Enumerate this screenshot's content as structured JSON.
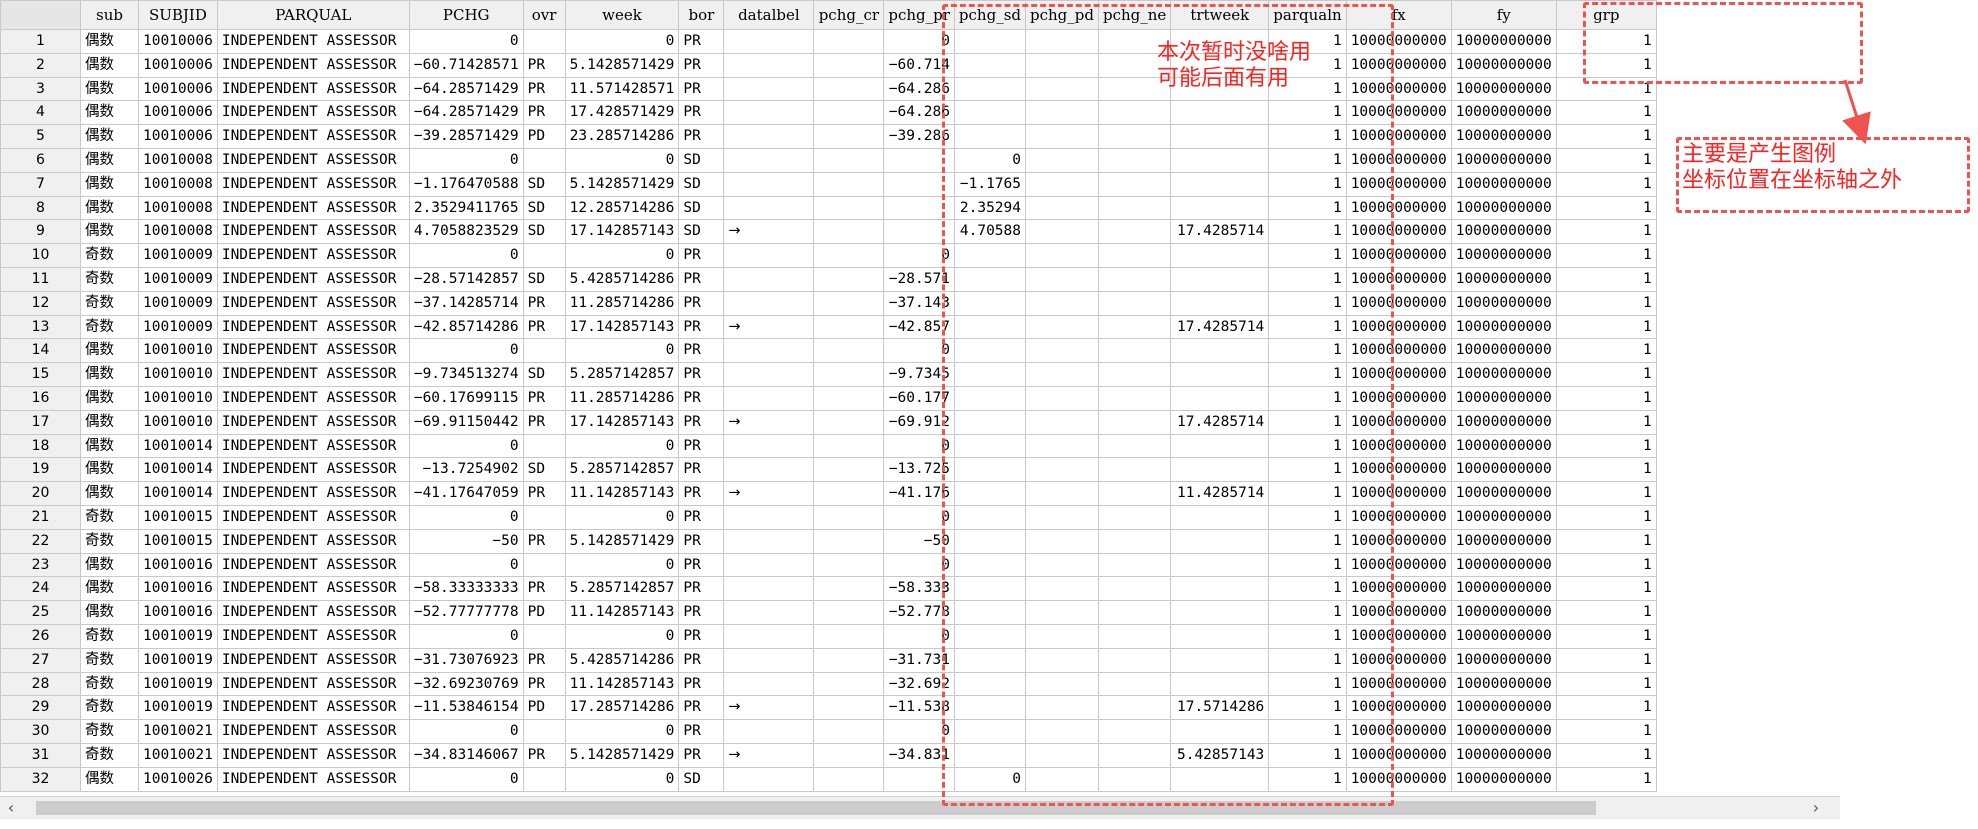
{
  "columns": [
    "sub",
    "SUBJID",
    "PARQUAL",
    "PCHG",
    "ovr",
    "week",
    "bor",
    "datalbel",
    "pchg_cr",
    "pchg_pr",
    "pchg_sd",
    "pchg_pd",
    "pchg_ne",
    "trtweek",
    "parqualn",
    "fx",
    "fy",
    "grp"
  ],
  "rows": [
    {
      "n": "1",
      "sub": "偶数",
      "subjid": "10010006",
      "parqual": "INDEPENDENT ASSESSOR",
      "pchg": "0",
      "ovr": "",
      "week": "0",
      "bor": "PR",
      "datalbel": "",
      "pchg_pr": "0",
      "pchg_sd": "",
      "trtweek": ""
    },
    {
      "n": "2",
      "sub": "偶数",
      "subjid": "10010006",
      "parqual": "INDEPENDENT ASSESSOR",
      "pchg": "−60.71428571",
      "ovr": "PR",
      "week": "5.1428571429",
      "bor": "PR",
      "datalbel": "",
      "pchg_pr": "−60.714",
      "pchg_sd": "",
      "trtweek": ""
    },
    {
      "n": "3",
      "sub": "偶数",
      "subjid": "10010006",
      "parqual": "INDEPENDENT ASSESSOR",
      "pchg": "−64.28571429",
      "ovr": "PR",
      "week": "11.571428571",
      "bor": "PR",
      "datalbel": "",
      "pchg_pr": "−64.286",
      "pchg_sd": "",
      "trtweek": ""
    },
    {
      "n": "4",
      "sub": "偶数",
      "subjid": "10010006",
      "parqual": "INDEPENDENT ASSESSOR",
      "pchg": "−64.28571429",
      "ovr": "PR",
      "week": "17.428571429",
      "bor": "PR",
      "datalbel": "",
      "pchg_pr": "−64.286",
      "pchg_sd": "",
      "trtweek": ""
    },
    {
      "n": "5",
      "sub": "偶数",
      "subjid": "10010006",
      "parqual": "INDEPENDENT ASSESSOR",
      "pchg": "−39.28571429",
      "ovr": "PD",
      "week": "23.285714286",
      "bor": "PR",
      "datalbel": "",
      "pchg_pr": "−39.286",
      "pchg_sd": "",
      "trtweek": ""
    },
    {
      "n": "6",
      "sub": "偶数",
      "subjid": "10010008",
      "parqual": "INDEPENDENT ASSESSOR",
      "pchg": "0",
      "ovr": "",
      "week": "0",
      "bor": "SD",
      "datalbel": "",
      "pchg_pr": "",
      "pchg_sd": "0",
      "trtweek": ""
    },
    {
      "n": "7",
      "sub": "偶数",
      "subjid": "10010008",
      "parqual": "INDEPENDENT ASSESSOR",
      "pchg": "−1.176470588",
      "ovr": "SD",
      "week": "5.1428571429",
      "bor": "SD",
      "datalbel": "",
      "pchg_pr": "",
      "pchg_sd": "−1.1765",
      "trtweek": ""
    },
    {
      "n": "8",
      "sub": "偶数",
      "subjid": "10010008",
      "parqual": "INDEPENDENT ASSESSOR",
      "pchg": "2.3529411765",
      "ovr": "SD",
      "week": "12.285714286",
      "bor": "SD",
      "datalbel": "",
      "pchg_pr": "",
      "pchg_sd": "2.35294",
      "trtweek": ""
    },
    {
      "n": "9",
      "sub": "偶数",
      "subjid": "10010008",
      "parqual": "INDEPENDENT ASSESSOR",
      "pchg": "4.7058823529",
      "ovr": "SD",
      "week": "17.142857143",
      "bor": "SD",
      "datalbel": "→",
      "pchg_pr": "",
      "pchg_sd": "4.70588",
      "trtweek": "17.4285714"
    },
    {
      "n": "10",
      "sub": "奇数",
      "subjid": "10010009",
      "parqual": "INDEPENDENT ASSESSOR",
      "pchg": "0",
      "ovr": "",
      "week": "0",
      "bor": "PR",
      "datalbel": "",
      "pchg_pr": "0",
      "pchg_sd": "",
      "trtweek": ""
    },
    {
      "n": "11",
      "sub": "奇数",
      "subjid": "10010009",
      "parqual": "INDEPENDENT ASSESSOR",
      "pchg": "−28.57142857",
      "ovr": "SD",
      "week": "5.4285714286",
      "bor": "PR",
      "datalbel": "",
      "pchg_pr": "−28.571",
      "pchg_sd": "",
      "trtweek": ""
    },
    {
      "n": "12",
      "sub": "奇数",
      "subjid": "10010009",
      "parqual": "INDEPENDENT ASSESSOR",
      "pchg": "−37.14285714",
      "ovr": "PR",
      "week": "11.285714286",
      "bor": "PR",
      "datalbel": "",
      "pchg_pr": "−37.143",
      "pchg_sd": "",
      "trtweek": ""
    },
    {
      "n": "13",
      "sub": "奇数",
      "subjid": "10010009",
      "parqual": "INDEPENDENT ASSESSOR",
      "pchg": "−42.85714286",
      "ovr": "PR",
      "week": "17.142857143",
      "bor": "PR",
      "datalbel": "→",
      "pchg_pr": "−42.857",
      "pchg_sd": "",
      "trtweek": "17.4285714"
    },
    {
      "n": "14",
      "sub": "偶数",
      "subjid": "10010010",
      "parqual": "INDEPENDENT ASSESSOR",
      "pchg": "0",
      "ovr": "",
      "week": "0",
      "bor": "PR",
      "datalbel": "",
      "pchg_pr": "0",
      "pchg_sd": "",
      "trtweek": ""
    },
    {
      "n": "15",
      "sub": "偶数",
      "subjid": "10010010",
      "parqual": "INDEPENDENT ASSESSOR",
      "pchg": "−9.734513274",
      "ovr": "SD",
      "week": "5.2857142857",
      "bor": "PR",
      "datalbel": "",
      "pchg_pr": "−9.7345",
      "pchg_sd": "",
      "trtweek": ""
    },
    {
      "n": "16",
      "sub": "偶数",
      "subjid": "10010010",
      "parqual": "INDEPENDENT ASSESSOR",
      "pchg": "−60.17699115",
      "ovr": "PR",
      "week": "11.285714286",
      "bor": "PR",
      "datalbel": "",
      "pchg_pr": "−60.177",
      "pchg_sd": "",
      "trtweek": ""
    },
    {
      "n": "17",
      "sub": "偶数",
      "subjid": "10010010",
      "parqual": "INDEPENDENT ASSESSOR",
      "pchg": "−69.91150442",
      "ovr": "PR",
      "week": "17.142857143",
      "bor": "PR",
      "datalbel": "→",
      "pchg_pr": "−69.912",
      "pchg_sd": "",
      "trtweek": "17.4285714"
    },
    {
      "n": "18",
      "sub": "偶数",
      "subjid": "10010014",
      "parqual": "INDEPENDENT ASSESSOR",
      "pchg": "0",
      "ovr": "",
      "week": "0",
      "bor": "PR",
      "datalbel": "",
      "pchg_pr": "0",
      "pchg_sd": "",
      "trtweek": ""
    },
    {
      "n": "19",
      "sub": "偶数",
      "subjid": "10010014",
      "parqual": "INDEPENDENT ASSESSOR",
      "pchg": "−13.7254902",
      "ovr": "SD",
      "week": "5.2857142857",
      "bor": "PR",
      "datalbel": "",
      "pchg_pr": "−13.725",
      "pchg_sd": "",
      "trtweek": ""
    },
    {
      "n": "20",
      "sub": "偶数",
      "subjid": "10010014",
      "parqual": "INDEPENDENT ASSESSOR",
      "pchg": "−41.17647059",
      "ovr": "PR",
      "week": "11.142857143",
      "bor": "PR",
      "datalbel": "→",
      "pchg_pr": "−41.176",
      "pchg_sd": "",
      "trtweek": "11.4285714"
    },
    {
      "n": "21",
      "sub": "奇数",
      "subjid": "10010015",
      "parqual": "INDEPENDENT ASSESSOR",
      "pchg": "0",
      "ovr": "",
      "week": "0",
      "bor": "PR",
      "datalbel": "",
      "pchg_pr": "0",
      "pchg_sd": "",
      "trtweek": ""
    },
    {
      "n": "22",
      "sub": "奇数",
      "subjid": "10010015",
      "parqual": "INDEPENDENT ASSESSOR",
      "pchg": "−50",
      "ovr": "PR",
      "week": "5.1428571429",
      "bor": "PR",
      "datalbel": "",
      "pchg_pr": "−50",
      "pchg_sd": "",
      "trtweek": ""
    },
    {
      "n": "23",
      "sub": "偶数",
      "subjid": "10010016",
      "parqual": "INDEPENDENT ASSESSOR",
      "pchg": "0",
      "ovr": "",
      "week": "0",
      "bor": "PR",
      "datalbel": "",
      "pchg_pr": "0",
      "pchg_sd": "",
      "trtweek": ""
    },
    {
      "n": "24",
      "sub": "偶数",
      "subjid": "10010016",
      "parqual": "INDEPENDENT ASSESSOR",
      "pchg": "−58.33333333",
      "ovr": "PR",
      "week": "5.2857142857",
      "bor": "PR",
      "datalbel": "",
      "pchg_pr": "−58.333",
      "pchg_sd": "",
      "trtweek": ""
    },
    {
      "n": "25",
      "sub": "偶数",
      "subjid": "10010016",
      "parqual": "INDEPENDENT ASSESSOR",
      "pchg": "−52.77777778",
      "ovr": "PD",
      "week": "11.142857143",
      "bor": "PR",
      "datalbel": "",
      "pchg_pr": "−52.778",
      "pchg_sd": "",
      "trtweek": ""
    },
    {
      "n": "26",
      "sub": "奇数",
      "subjid": "10010019",
      "parqual": "INDEPENDENT ASSESSOR",
      "pchg": "0",
      "ovr": "",
      "week": "0",
      "bor": "PR",
      "datalbel": "",
      "pchg_pr": "0",
      "pchg_sd": "",
      "trtweek": ""
    },
    {
      "n": "27",
      "sub": "奇数",
      "subjid": "10010019",
      "parqual": "INDEPENDENT ASSESSOR",
      "pchg": "−31.73076923",
      "ovr": "PR",
      "week": "5.4285714286",
      "bor": "PR",
      "datalbel": "",
      "pchg_pr": "−31.731",
      "pchg_sd": "",
      "trtweek": ""
    },
    {
      "n": "28",
      "sub": "奇数",
      "subjid": "10010019",
      "parqual": "INDEPENDENT ASSESSOR",
      "pchg": "−32.69230769",
      "ovr": "PR",
      "week": "11.142857143",
      "bor": "PR",
      "datalbel": "",
      "pchg_pr": "−32.692",
      "pchg_sd": "",
      "trtweek": ""
    },
    {
      "n": "29",
      "sub": "奇数",
      "subjid": "10010019",
      "parqual": "INDEPENDENT ASSESSOR",
      "pchg": "−11.53846154",
      "ovr": "PD",
      "week": "17.285714286",
      "bor": "PR",
      "datalbel": "→",
      "pchg_pr": "−11.538",
      "pchg_sd": "",
      "trtweek": "17.5714286"
    },
    {
      "n": "30",
      "sub": "奇数",
      "subjid": "10010021",
      "parqual": "INDEPENDENT ASSESSOR",
      "pchg": "0",
      "ovr": "",
      "week": "0",
      "bor": "PR",
      "datalbel": "",
      "pchg_pr": "0",
      "pchg_sd": "",
      "trtweek": ""
    },
    {
      "n": "31",
      "sub": "奇数",
      "subjid": "10010021",
      "parqual": "INDEPENDENT ASSESSOR",
      "pchg": "−34.83146067",
      "ovr": "PR",
      "week": "5.1428571429",
      "bor": "PR",
      "datalbel": "→",
      "pchg_pr": "−34.831",
      "pchg_sd": "",
      "trtweek": "5.42857143"
    },
    {
      "n": "32",
      "sub": "偶数",
      "subjid": "10010026",
      "parqual": "INDEPENDENT ASSESSOR",
      "pchg": "0",
      "ovr": "",
      "week": "0",
      "bor": "SD",
      "datalbel": "",
      "pchg_pr": "",
      "pchg_sd": "0",
      "trtweek": ""
    }
  ],
  "const_values": {
    "parqualn": "1",
    "fx": "10000000000",
    "fy": "10000000000",
    "grp": "1"
  },
  "annotations": {
    "middle_line1": "本次暂时没啥用",
    "middle_line2": "可能后面有用",
    "right_line1": "主要是产生图例",
    "right_line2": "坐标位置在坐标轴之外"
  },
  "scrollbar": {
    "left_arrow": "‹",
    "right_arrow": "›"
  },
  "colors": {
    "annotation": "#ff2020",
    "dashed_box": "#ef5350",
    "header_bg": "#f0f0f0"
  }
}
